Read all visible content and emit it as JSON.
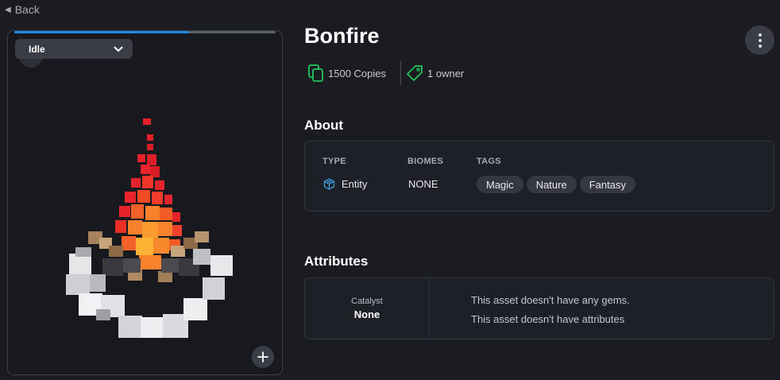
{
  "nav": {
    "back_label": "Back"
  },
  "viewer": {
    "animation_selected": "Idle",
    "playback_progress": 0.67,
    "model_name": "bonfire-voxel-model"
  },
  "asset": {
    "title": "Bonfire",
    "copies_label": "1500 Copies",
    "owners_label": "1 owner"
  },
  "about": {
    "heading": "About",
    "type_header": "TYPE",
    "type_value": "Entity",
    "biomes_header": "BIOMES",
    "biomes_value": "NONE",
    "tags_header": "TAGS",
    "tags": [
      "Magic",
      "Nature",
      "Fantasy"
    ]
  },
  "attributes": {
    "heading": "Attributes",
    "catalyst_label": "Catalyst",
    "catalyst_value": "None",
    "gems_message": "This asset doesn't have any gems.",
    "attributes_message": "This asset doesn't have attributes"
  },
  "colors": {
    "accent_green": "#22c55e",
    "progress_blue": "#1e88e5",
    "background": "#1a1c21"
  },
  "icons": [
    "chevron-left-icon",
    "chevron-down-icon",
    "plus-icon",
    "more-vertical-icon",
    "copies-icon",
    "tag-icon",
    "cube-icon"
  ]
}
